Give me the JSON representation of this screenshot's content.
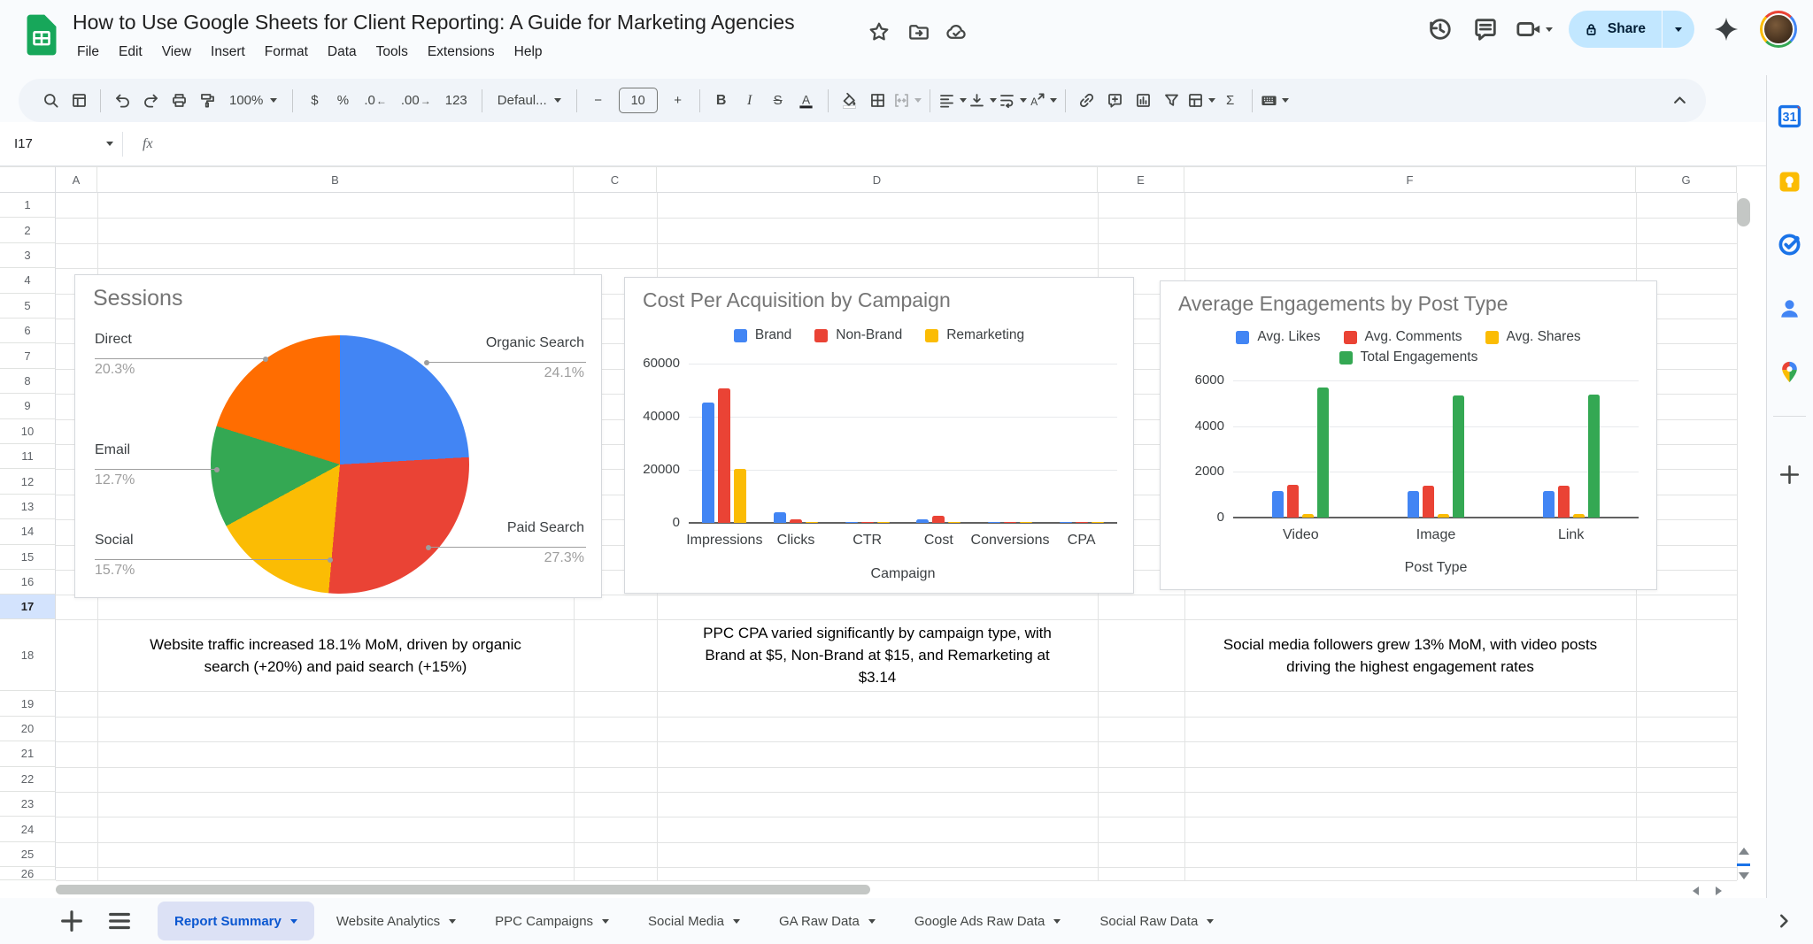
{
  "app": {
    "title": "How to Use Google Sheets for Client Reporting: A Guide for Marketing Agencies",
    "menus": [
      "File",
      "Edit",
      "View",
      "Insert",
      "Format",
      "Data",
      "Tools",
      "Extensions",
      "Help"
    ],
    "doc_icons": [
      "star-icon",
      "move-folder-icon",
      "cloud-saved-icon"
    ]
  },
  "topbar_right": {
    "icons": [
      "history-icon",
      "comment-icon",
      "video-call-icon"
    ],
    "share_label": "Share",
    "extra_icons": [
      "gemini-icon",
      "avatar"
    ]
  },
  "toolbar": {
    "zoom_value": "100%",
    "font_value": "Defaul...",
    "font_size_value": "10",
    "items": [
      {
        "kind": "icon",
        "icon": "search-icon",
        "name": "search-button"
      },
      {
        "kind": "icon",
        "icon": "sheet-view-icon",
        "name": "filter-views-button"
      },
      {
        "kind": "divider"
      },
      {
        "kind": "icon",
        "icon": "undo-icon",
        "name": "undo-button"
      },
      {
        "kind": "icon",
        "icon": "redo-icon",
        "name": "redo-button"
      },
      {
        "kind": "icon",
        "icon": "print-icon",
        "name": "print-button"
      },
      {
        "kind": "icon",
        "icon": "paint-format-icon",
        "name": "paint-format-button"
      },
      {
        "kind": "dropdown",
        "bind": "zoom_value",
        "name": "zoom-select"
      },
      {
        "kind": "divider"
      },
      {
        "kind": "text",
        "label": "$",
        "name": "format-currency-button"
      },
      {
        "kind": "text",
        "label": "%",
        "name": "format-percent-button"
      },
      {
        "kind": "decimal",
        "label": ".0",
        "arrow": "←",
        "name": "decrease-decimal-button"
      },
      {
        "kind": "decimal",
        "label": ".00",
        "arrow": "→",
        "name": "increase-decimal-button"
      },
      {
        "kind": "text",
        "label": "123",
        "name": "more-formats-button"
      },
      {
        "kind": "divider"
      },
      {
        "kind": "dropdown",
        "bind": "font_value",
        "name": "font-select"
      },
      {
        "kind": "divider"
      },
      {
        "kind": "text",
        "label": "−",
        "name": "decrease-font-size-button"
      },
      {
        "kind": "box",
        "bind": "font_size_value",
        "name": "font-size-input"
      },
      {
        "kind": "text",
        "label": "+",
        "name": "increase-font-size-button"
      },
      {
        "kind": "divider"
      },
      {
        "kind": "text",
        "label": "B",
        "cls": "b",
        "name": "bold-button"
      },
      {
        "kind": "text",
        "label": "I",
        "cls": "i",
        "name": "italic-button"
      },
      {
        "kind": "text",
        "label": "S",
        "cls": "s",
        "name": "strikethrough-button"
      },
      {
        "kind": "icon",
        "icon": "text-color-icon",
        "name": "text-color-button"
      },
      {
        "kind": "divider"
      },
      {
        "kind": "icon",
        "icon": "fill-color-icon",
        "name": "fill-color-button"
      },
      {
        "kind": "icon",
        "icon": "borders-icon",
        "name": "borders-button"
      },
      {
        "kind": "icon",
        "icon": "merge-cells-icon",
        "caret": true,
        "disabled": true,
        "name": "merge-cells-button"
      },
      {
        "kind": "divider"
      },
      {
        "kind": "icon",
        "icon": "align-left-icon",
        "caret": true,
        "name": "horizontal-align-button"
      },
      {
        "kind": "icon",
        "icon": "vertical-align-icon",
        "caret": true,
        "name": "vertical-align-button"
      },
      {
        "kind": "icon",
        "icon": "text-wrap-icon",
        "caret": true,
        "name": "text-wrap-button"
      },
      {
        "kind": "icon",
        "icon": "text-rotate-icon",
        "caret": true,
        "name": "text-rotation-button"
      },
      {
        "kind": "divider"
      },
      {
        "kind": "icon",
        "icon": "insert-link-icon",
        "name": "insert-link-button"
      },
      {
        "kind": "icon",
        "icon": "insert-comment-icon",
        "name": "insert-comment-button"
      },
      {
        "kind": "icon",
        "icon": "insert-chart-icon",
        "name": "insert-chart-button"
      },
      {
        "kind": "icon",
        "icon": "filter-icon",
        "name": "create-filter-button"
      },
      {
        "kind": "icon",
        "icon": "table-icon",
        "caret": true,
        "name": "table-button"
      },
      {
        "kind": "text",
        "label": "Σ",
        "name": "functions-button"
      },
      {
        "kind": "divider"
      },
      {
        "kind": "icon",
        "icon": "keyboard-icon",
        "caret": true,
        "name": "input-tools-button"
      }
    ]
  },
  "formula_bar": {
    "cell_ref": "I17",
    "fx_label": "fx"
  },
  "grid": {
    "columns": [
      "A",
      "B",
      "C",
      "D",
      "E",
      "F",
      "G"
    ],
    "rows": [
      "1",
      "2",
      "3",
      "4",
      "5",
      "6",
      "7",
      "8",
      "9",
      "10",
      "11",
      "12",
      "13",
      "14",
      "15",
      "16",
      "17",
      "18",
      "19",
      "20",
      "21",
      "22",
      "23",
      "24",
      "25",
      "26"
    ],
    "selected_cell": "I17",
    "selected_row": "17"
  },
  "notes": [
    {
      "column": "B",
      "text": "Website traffic increased 18.1% MoM, driven by organic search (+20%) and paid search (+15%)"
    },
    {
      "column": "D",
      "text": "PPC CPA varied significantly by campaign type, with Brand at $5, Non-Brand at $15, and Remarketing at $3.14"
    },
    {
      "column": "F",
      "text": "Social media followers grew 13% MoM, with video posts driving the highest engagement rates"
    }
  ],
  "chart_data": [
    {
      "type": "pie",
      "title": "Sessions",
      "slices": [
        {
          "label": "Organic Search",
          "pct": 24.1,
          "color": "#4285f4"
        },
        {
          "label": "Paid Search",
          "pct": 27.3,
          "color": "#ea4335"
        },
        {
          "label": "Social",
          "pct": 15.7,
          "color": "#fbbc04"
        },
        {
          "label": "Email",
          "pct": 12.7,
          "color": "#34a853"
        },
        {
          "label": "Direct",
          "pct": 20.3,
          "color": "#ff6d01"
        }
      ],
      "start_angle_deg": 0,
      "legend_position": "outside-callouts"
    },
    {
      "type": "bar",
      "title": "Cost Per Acquisition by Campaign",
      "xlabel": "Campaign",
      "categories": [
        "Impressions",
        "Clicks",
        "CTR",
        "Cost",
        "Conversions",
        "CPA"
      ],
      "series": [
        {
          "name": "Brand",
          "color": "#4285f4",
          "values": [
            45200,
            4000,
            10,
            1300,
            250,
            5
          ]
        },
        {
          "name": "Non-Brand",
          "color": "#ea4335",
          "values": [
            50800,
            1400,
            4,
            2600,
            170,
            15
          ]
        },
        {
          "name": "Remarketing",
          "color": "#fbbc04",
          "values": [
            20400,
            500,
            2,
            300,
            100,
            3.14
          ]
        }
      ],
      "ylim": [
        0,
        60000
      ],
      "yticks": [
        0,
        20000,
        40000,
        60000
      ],
      "legend_position": "top",
      "grid": true
    },
    {
      "type": "bar",
      "title": "Average Engagements by Post Type",
      "xlabel": "Post Type",
      "categories": [
        "Video",
        "Image",
        "Link"
      ],
      "series": [
        {
          "name": "Avg. Likes",
          "color": "#4285f4",
          "values": [
            1150,
            1150,
            1150
          ]
        },
        {
          "name": "Avg. Comments",
          "color": "#ea4335",
          "values": [
            1450,
            1380,
            1380
          ]
        },
        {
          "name": "Avg. Shares",
          "color": "#fbbc04",
          "values": [
            170,
            160,
            160
          ]
        },
        {
          "name": "Total Engagements",
          "color": "#34a853",
          "values": [
            5700,
            5350,
            5380
          ]
        }
      ],
      "ylim": [
        0,
        6000
      ],
      "yticks": [
        0,
        2000,
        4000,
        6000
      ],
      "legend_position": "top",
      "grid": true
    }
  ],
  "sheet_tabs": {
    "tabs": [
      {
        "label": "Report Summary",
        "active": true
      },
      {
        "label": "Website Analytics",
        "active": false
      },
      {
        "label": "PPC Campaigns",
        "active": false
      },
      {
        "label": "Social Media",
        "active": false
      },
      {
        "label": "GA Raw Data",
        "active": false
      },
      {
        "label": "Google Ads Raw Data",
        "active": false
      },
      {
        "label": "Social Raw Data",
        "active": false
      }
    ]
  },
  "sidebar_apps": [
    "calendar-icon",
    "keep-icon",
    "tasks-icon",
    "contacts-icon",
    "maps-icon",
    "get-addons-icon"
  ],
  "colors": {
    "chart_blue": "#4285f4",
    "chart_red": "#ea4335",
    "chart_yellow": "#fbbc04",
    "chart_green": "#34a853",
    "chart_orange": "#ff6d01",
    "share_bg": "#c2e7ff",
    "active_tab_text": "#0b57d0",
    "selected_header_bg": "#d3e3fd",
    "accent_blue": "#1a73e8"
  }
}
